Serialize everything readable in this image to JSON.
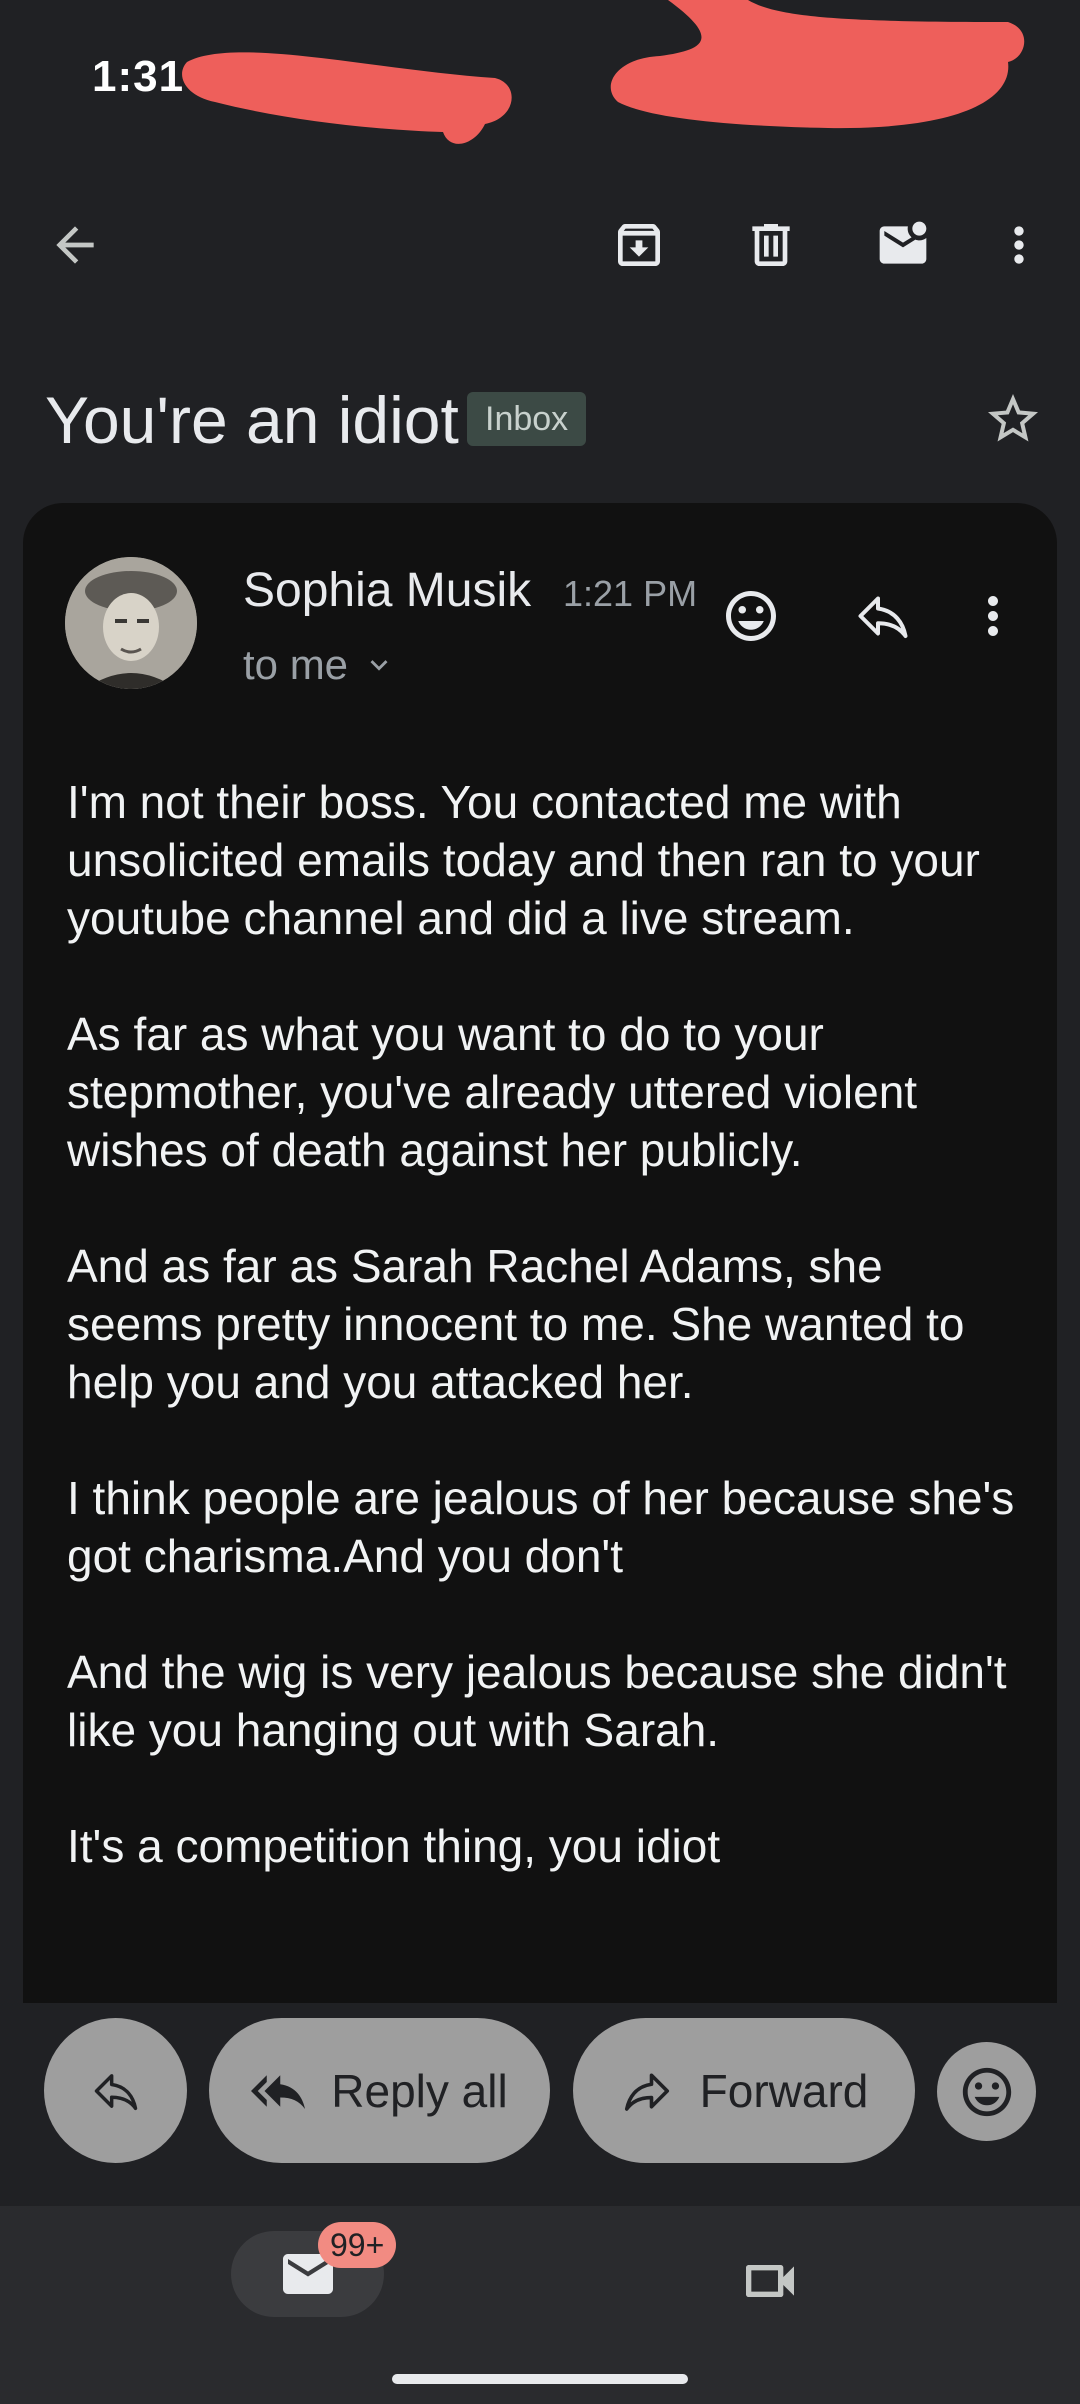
{
  "status_bar": {
    "time": "1:31"
  },
  "toolbar": {
    "back_icon": "arrow-left-icon",
    "archive_icon": "archive-icon",
    "delete_icon": "trash-icon",
    "mark_unread_icon": "mail-unread-icon",
    "more_icon": "more-vertical-icon"
  },
  "subject": {
    "text": "You're an idiot",
    "label": "Inbox"
  },
  "message": {
    "sender": "Sophia Musik",
    "time": "1:21 PM",
    "recipient": "to me",
    "paragraphs": [
      "I'm not their boss. You contacted me with unsolicited emails today and then ran to your youtube channel and did a live stream.",
      "As far as what you want to do to your stepmother, you've already uttered violent wishes of death against her publicly.",
      "And as far as Sarah Rachel Adams, she seems pretty innocent to me. She wanted to help you and you attacked her.",
      "I think people are jealous of her because she's got charisma.And you don't",
      "And the wig is very jealous because she didn't like you hanging out with Sarah.",
      "It's a competition thing, you idiot"
    ]
  },
  "actions": {
    "reply_all": "Reply all",
    "forward": "Forward"
  },
  "bottom_nav": {
    "mail_badge": "99+"
  },
  "colors": {
    "background": "#202124",
    "card": "#111111",
    "pill": "#9e9e9e",
    "badge": "#f28b82",
    "redaction": "#ee5f5b"
  }
}
